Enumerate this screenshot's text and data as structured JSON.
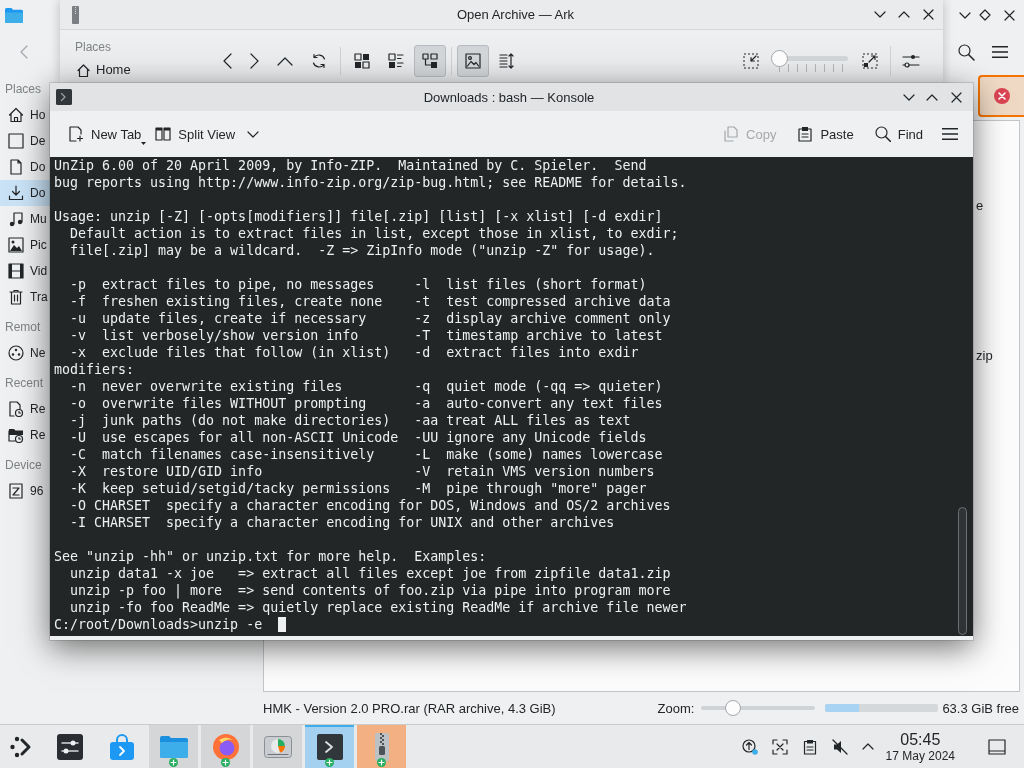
{
  "dolphin": {
    "sidebar": [
      {
        "heading": "Places",
        "items": [
          {
            "kind": "home",
            "label": "Ho",
            "selected": false
          },
          {
            "kind": "desktop",
            "label": "De",
            "selected": false
          },
          {
            "kind": "documents",
            "label": "Do",
            "selected": false
          },
          {
            "kind": "downloads",
            "label": "Do",
            "selected": true
          },
          {
            "kind": "music",
            "label": "Mu",
            "selected": false
          },
          {
            "kind": "pictures",
            "label": "Pic",
            "selected": false
          },
          {
            "kind": "videos",
            "label": "Vid",
            "selected": false
          },
          {
            "kind": "trash",
            "label": "Tra",
            "selected": false
          }
        ]
      },
      {
        "heading": "Remot",
        "items": [
          {
            "kind": "network",
            "label": "Ne",
            "selected": false
          }
        ]
      },
      {
        "heading": "Recent",
        "items": [
          {
            "kind": "recent-files",
            "label": "Re",
            "selected": false
          },
          {
            "kind": "recent-locations",
            "label": "Re",
            "selected": false
          }
        ]
      },
      {
        "heading": "Device",
        "items": [
          {
            "kind": "drive",
            "label": "96",
            "selected": false
          }
        ]
      }
    ],
    "view_fragments": [
      "e",
      "zip"
    ],
    "status_bar": {
      "file_info": "HMK - Version 2.0 PRO.rar (RAR archive, 4.3 GiB)",
      "zoom_label": "Zoom:",
      "zoom": {
        "level": 0.25
      },
      "free_space": {
        "level": 0.3
      },
      "free_label": "63.3 GiB free"
    }
  },
  "ark": {
    "title": "Open Archive — Ark",
    "places": {
      "heading": "Places",
      "items": [
        {
          "kind": "home",
          "label": "Home"
        }
      ]
    },
    "view_modes": [
      {
        "kind": "icons",
        "selected": false
      },
      {
        "kind": "compact",
        "selected": false
      },
      {
        "kind": "details",
        "selected": true
      }
    ],
    "preview": {
      "checked": true
    },
    "icon_size": {
      "level": 0
    }
  },
  "konsole": {
    "title": "Downloads : bash — Konsole",
    "toolbar_left": [
      {
        "kind": "new-tab",
        "label": "New Tab",
        "disabled": false
      },
      {
        "kind": "split-view",
        "label": "Split View",
        "disabled": false
      }
    ],
    "toolbar_right": [
      {
        "kind": "copy",
        "label": "Copy",
        "disabled": true
      },
      {
        "kind": "paste",
        "label": "Paste",
        "disabled": false
      },
      {
        "kind": "find",
        "label": "Find",
        "disabled": false
      }
    ],
    "output_blocks": [
      [
        "UnZip 6.00 of 20 April 2009, by Info-ZIP.  Maintained by C. Spieler.  Send",
        "bug reports using http://www.info-zip.org/zip-bug.html; see README for details."
      ],
      [
        "Usage: unzip [-Z] [-opts[modifiers]] file[.zip] [list] [-x xlist] [-d exdir]",
        "  Default action is to extract files in list, except those in xlist, to exdir;",
        "  file[.zip] may be a wildcard.  -Z => ZipInfo mode (\"unzip -Z\" for usage)."
      ],
      [
        "  -p  extract files to pipe, no messages     -l  list files (short format)",
        "  -f  freshen existing files, create none    -t  test compressed archive data",
        "  -u  update files, create if necessary      -z  display archive comment only",
        "  -v  list verbosely/show version info       -T  timestamp archive to latest",
        "  -x  exclude files that follow (in xlist)   -d  extract files into exdir",
        "modifiers:",
        "  -n  never overwrite existing files         -q  quiet mode (-qq => quieter)",
        "  -o  overwrite files WITHOUT prompting      -a  auto-convert any text files",
        "  -j  junk paths (do not make directories)   -aa treat ALL files as text",
        "  -U  use escapes for all non-ASCII Unicode  -UU ignore any Unicode fields",
        "  -C  match filenames case-insensitively     -L  make (some) names lowercase",
        "  -X  restore UID/GID info                   -V  retain VMS version numbers",
        "  -K  keep setuid/setgid/tacky permissions   -M  pipe through \"more\" pager",
        "  -O CHARSET  specify a character encoding for DOS, Windows and OS/2 archives",
        "  -I CHARSET  specify a character encoding for UNIX and other archives"
      ],
      [
        "See \"unzip -hh\" or unzip.txt for more help.  Examples:",
        "  unzip data1 -x joe   => extract all files except joe from zipfile data1.zip",
        "  unzip -p foo | more  => send contents of foo.zip via pipe into program more",
        "  unzip -fo foo ReadMe => quietly replace existing ReadMe if archive file newer"
      ]
    ],
    "prompt": "C:/root/Downloads>unzip -e"
  },
  "taskbar": {
    "tasks": [
      {
        "kind": "launcher",
        "running": false,
        "selected": false,
        "attention": false,
        "emblem": false
      },
      {
        "kind": "settings",
        "running": false,
        "selected": false,
        "attention": false,
        "emblem": false
      },
      {
        "kind": "store",
        "running": false,
        "selected": false,
        "attention": false,
        "emblem": false
      },
      {
        "kind": "file-manager",
        "running": true,
        "selected": false,
        "attention": false,
        "emblem": true
      },
      {
        "kind": "browser",
        "running": true,
        "selected": false,
        "attention": false,
        "emblem": true
      },
      {
        "kind": "disk-tool",
        "running": true,
        "selected": false,
        "attention": false,
        "emblem": false
      },
      {
        "kind": "terminal",
        "running": true,
        "selected": true,
        "attention": false,
        "emblem": true
      },
      {
        "kind": "archiver",
        "running": true,
        "selected": false,
        "attention": true,
        "emblem": true
      }
    ],
    "clock": {
      "time": "05:45",
      "date": "17 May 2024"
    }
  }
}
